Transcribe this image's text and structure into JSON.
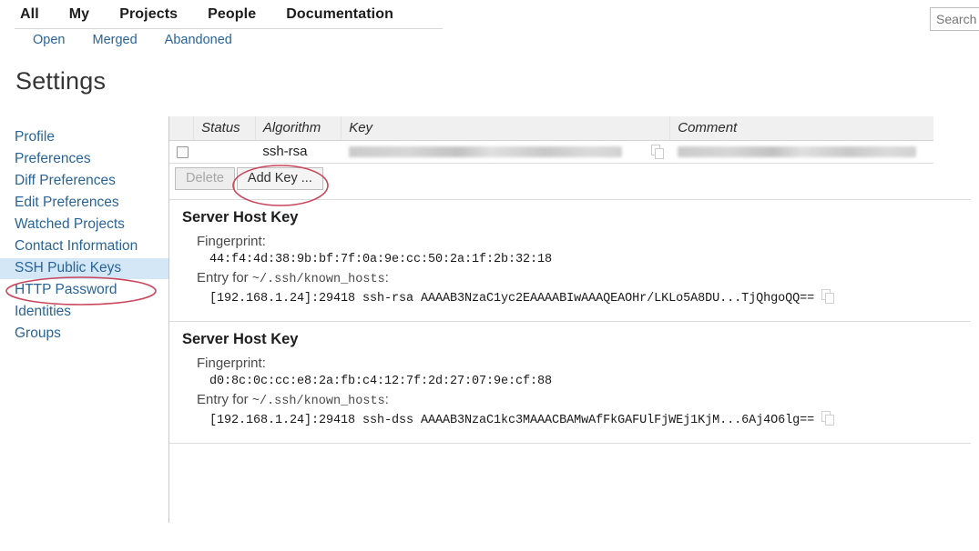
{
  "topnav": {
    "items": [
      {
        "label": "All"
      },
      {
        "label": "My"
      },
      {
        "label": "Projects"
      },
      {
        "label": "People"
      },
      {
        "label": "Documentation"
      }
    ]
  },
  "subnav": {
    "items": [
      {
        "label": "Open"
      },
      {
        "label": "Merged"
      },
      {
        "label": "Abandoned"
      }
    ]
  },
  "search": {
    "value": "",
    "placeholder": "Search"
  },
  "page": {
    "title": "Settings"
  },
  "sidebar": {
    "items": [
      {
        "label": "Profile",
        "active": false
      },
      {
        "label": "Preferences",
        "active": false
      },
      {
        "label": "Diff Preferences",
        "active": false
      },
      {
        "label": "Edit Preferences",
        "active": false
      },
      {
        "label": "Watched Projects",
        "active": false
      },
      {
        "label": "Contact Information",
        "active": false
      },
      {
        "label": "SSH Public Keys",
        "active": true
      },
      {
        "label": "HTTP Password",
        "active": false
      },
      {
        "label": "Identities",
        "active": false
      },
      {
        "label": "Groups",
        "active": false
      }
    ]
  },
  "keys_table": {
    "columns": [
      "",
      "Status",
      "Algorithm",
      "Key",
      "Comment"
    ],
    "rows": [
      {
        "checked": false,
        "status": "",
        "algorithm": "ssh-rsa",
        "key": "",
        "comment": "",
        "key_redacted": true,
        "comment_redacted": true
      }
    ]
  },
  "buttons": {
    "delete_label": "Delete",
    "delete_disabled": true,
    "add_key_label": "Add Key ..."
  },
  "host_keys": [
    {
      "heading": "Server Host Key",
      "fingerprint_label": "Fingerprint:",
      "fingerprint": "44:f4:4d:38:9b:bf:7f:0a:9e:cc:50:2a:1f:2b:32:18",
      "entry_label_prefix": "Entry for ",
      "entry_label_path": "~/.ssh/known_hosts",
      "entry_label_suffix": ":",
      "entry": "[192.168.1.24]:29418 ssh-rsa AAAAB3NzaC1yc2EAAAABIwAAAQEAOHr/LKLo5A8DU...TjQhgoQQ=="
    },
    {
      "heading": "Server Host Key",
      "fingerprint_label": "Fingerprint:",
      "fingerprint": "d0:8c:0c:cc:e8:2a:fb:c4:12:7f:2d:27:07:9e:cf:88",
      "entry_label_prefix": "Entry for ",
      "entry_label_path": "~/.ssh/known_hosts",
      "entry_label_suffix": ":",
      "entry": "[192.168.1.24]:29418 ssh-dss AAAAB3NzaC1kc3MAAACBAMwAfFkGAFUlFjWEj1KjM...6Aj4O6lg=="
    }
  ],
  "annotations": {
    "color": "#c9465b",
    "items": [
      {
        "name": "ellipse-ssh-public-keys"
      },
      {
        "name": "ellipse-add-key-button"
      }
    ]
  },
  "colors": {
    "link": "#2a6496",
    "active_bg": "#d3e7f7",
    "annotation": "#c9465b",
    "header_bg": "#f0f0f0"
  }
}
